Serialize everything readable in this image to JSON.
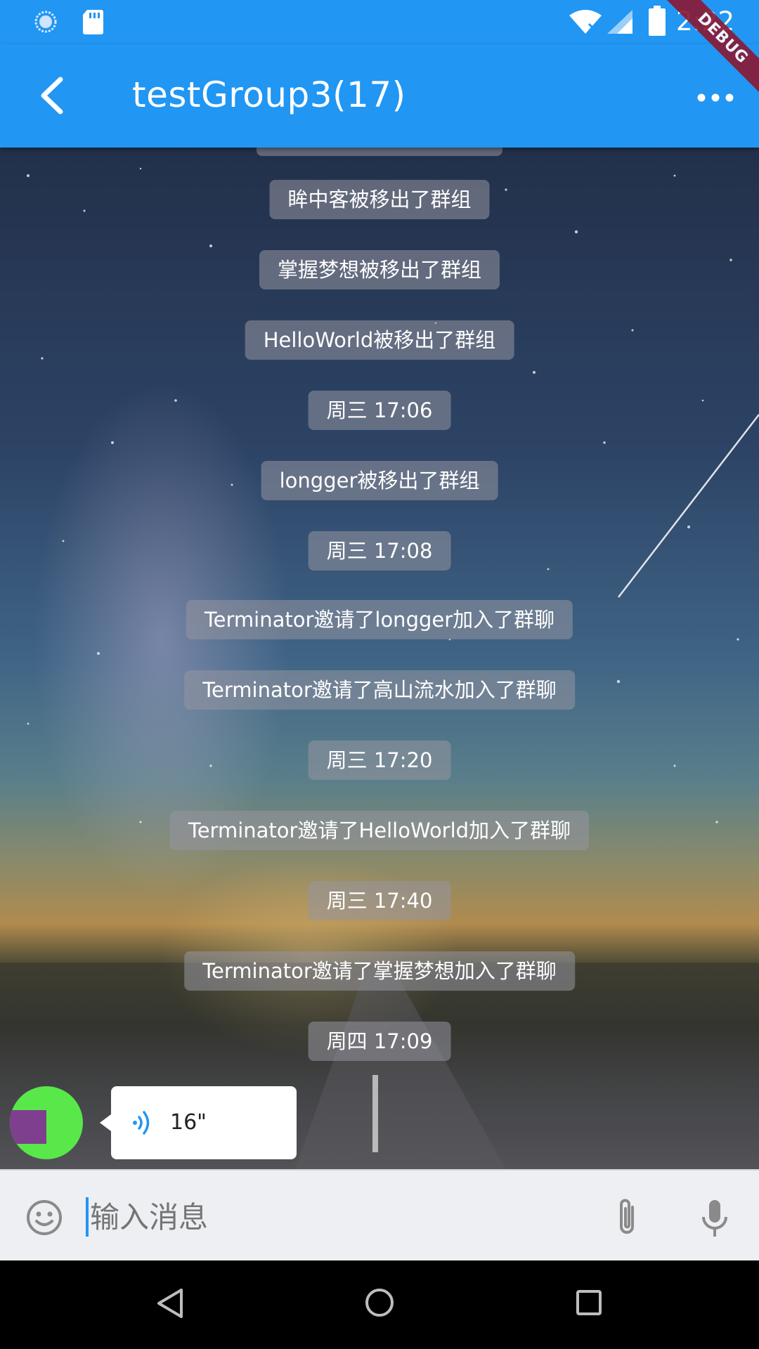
{
  "status_bar": {
    "time": "2:22",
    "icons": [
      "sync-icon",
      "sd-card-icon",
      "wifi-icon",
      "signal-icon",
      "battery-icon"
    ]
  },
  "app_bar": {
    "title": "testGroup3(17)",
    "back_icon": "back-arrow-icon",
    "more_icon": "more-horizontal-icon",
    "debug_banner": "DEBUG",
    "color": "#2196F3"
  },
  "chat": {
    "system_messages": [
      "眸中客被移出了群组",
      "掌握梦想被移出了群组",
      "HelloWorld被移出了群组",
      "周三 17:06",
      "longger被移出了群组",
      "周三 17:08",
      "Terminator邀请了longger加入了群聊",
      "Terminator邀请了高山流水加入了群聊",
      "周三 17:20",
      "Terminator邀请了HelloWorld加入了群聊",
      "周三 17:40",
      "Terminator邀请了掌握梦想加入了群聊",
      "周四 17:09"
    ],
    "voice_message": {
      "duration": "16\"",
      "icon": "voice-wave-icon"
    }
  },
  "input_bar": {
    "placeholder": "输入消息",
    "emoji_icon": "emoji-icon",
    "attach_icon": "attachment-icon",
    "mic_icon": "microphone-icon"
  },
  "nav_bar": {
    "icons": [
      "nav-back-icon",
      "nav-home-icon",
      "nav-recents-icon"
    ]
  }
}
